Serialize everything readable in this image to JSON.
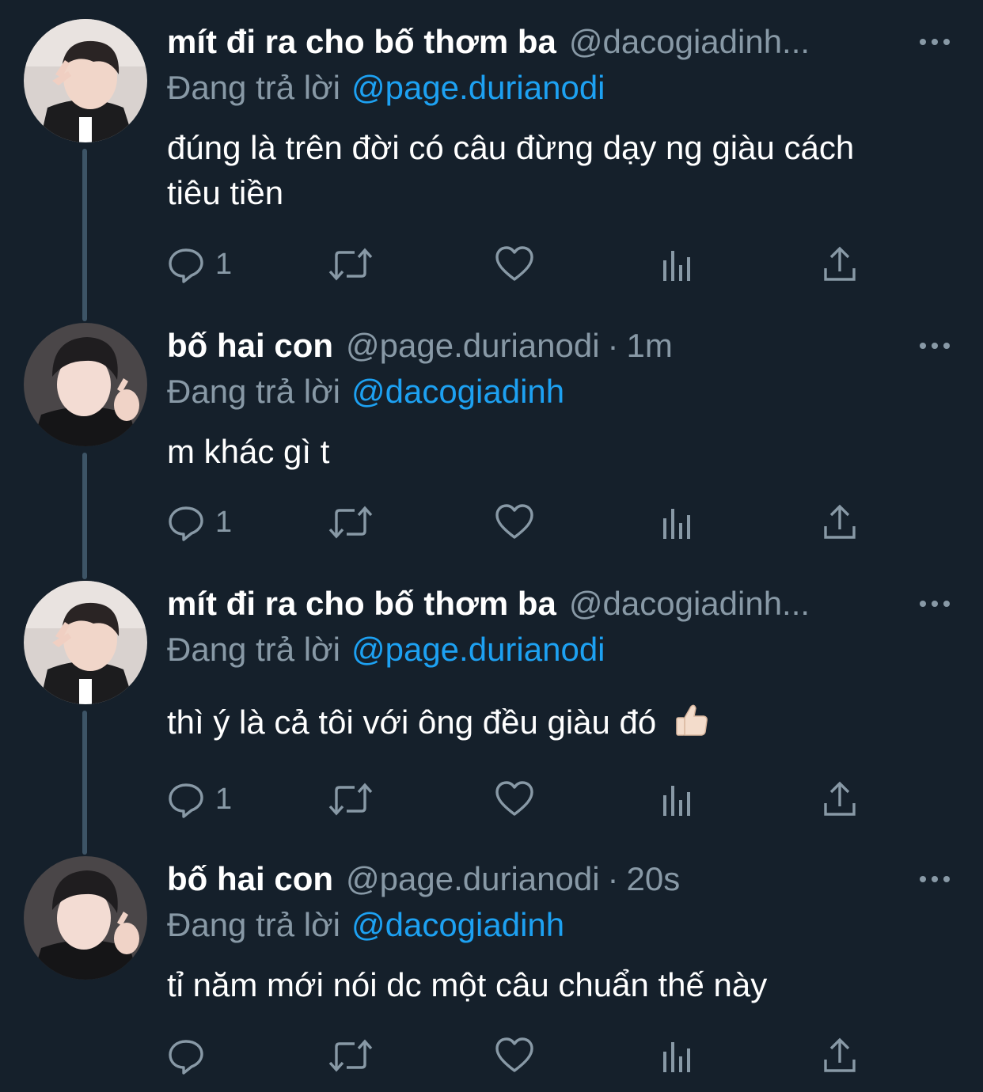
{
  "colors": {
    "background": "#15202b",
    "text_primary": "#ffffff",
    "text_secondary": "#8899a6",
    "accent": "#1da1f2",
    "thread_line": "#3d5466"
  },
  "reply_prefix": "Đang trả lời",
  "tweets": [
    {
      "display_name": "mít đi ra cho bố thơm ba",
      "handle": "@dacogiadinh...",
      "separator": "",
      "time": "",
      "reply_to": "@page.durianodi",
      "text": "đúng là trên đời có câu đừng dạy ng giàu cách tiêu tiền",
      "reply_count": "1",
      "emoji_icon": ""
    },
    {
      "display_name": "bố hai con",
      "handle": "@page.durianodi",
      "separator": "·",
      "time": "1m",
      "reply_to": "@dacogiadinh",
      "text": "m khác gì t",
      "reply_count": "1",
      "emoji_icon": ""
    },
    {
      "display_name": "mít đi ra cho bố thơm ba",
      "handle": "@dacogiadinh...",
      "separator": "",
      "time": "",
      "reply_to": "@page.durianodi",
      "text": "thì ý là cả tôi với ông đều giàu đó",
      "reply_count": "1",
      "emoji_icon": "thumbs-up-emoji"
    },
    {
      "display_name": "bố hai con",
      "handle": "@page.durianodi",
      "separator": "·",
      "time": "20s",
      "reply_to": "@dacogiadinh",
      "text": "tỉ năm mới nói dc một câu chuẩn thế này",
      "reply_count": "",
      "emoji_icon": ""
    }
  ],
  "icons": {
    "more": "more-options-icon",
    "reply": "reply-icon",
    "retweet": "retweet-icon",
    "like": "like-icon",
    "analytics": "analytics-icon",
    "share": "share-icon"
  }
}
